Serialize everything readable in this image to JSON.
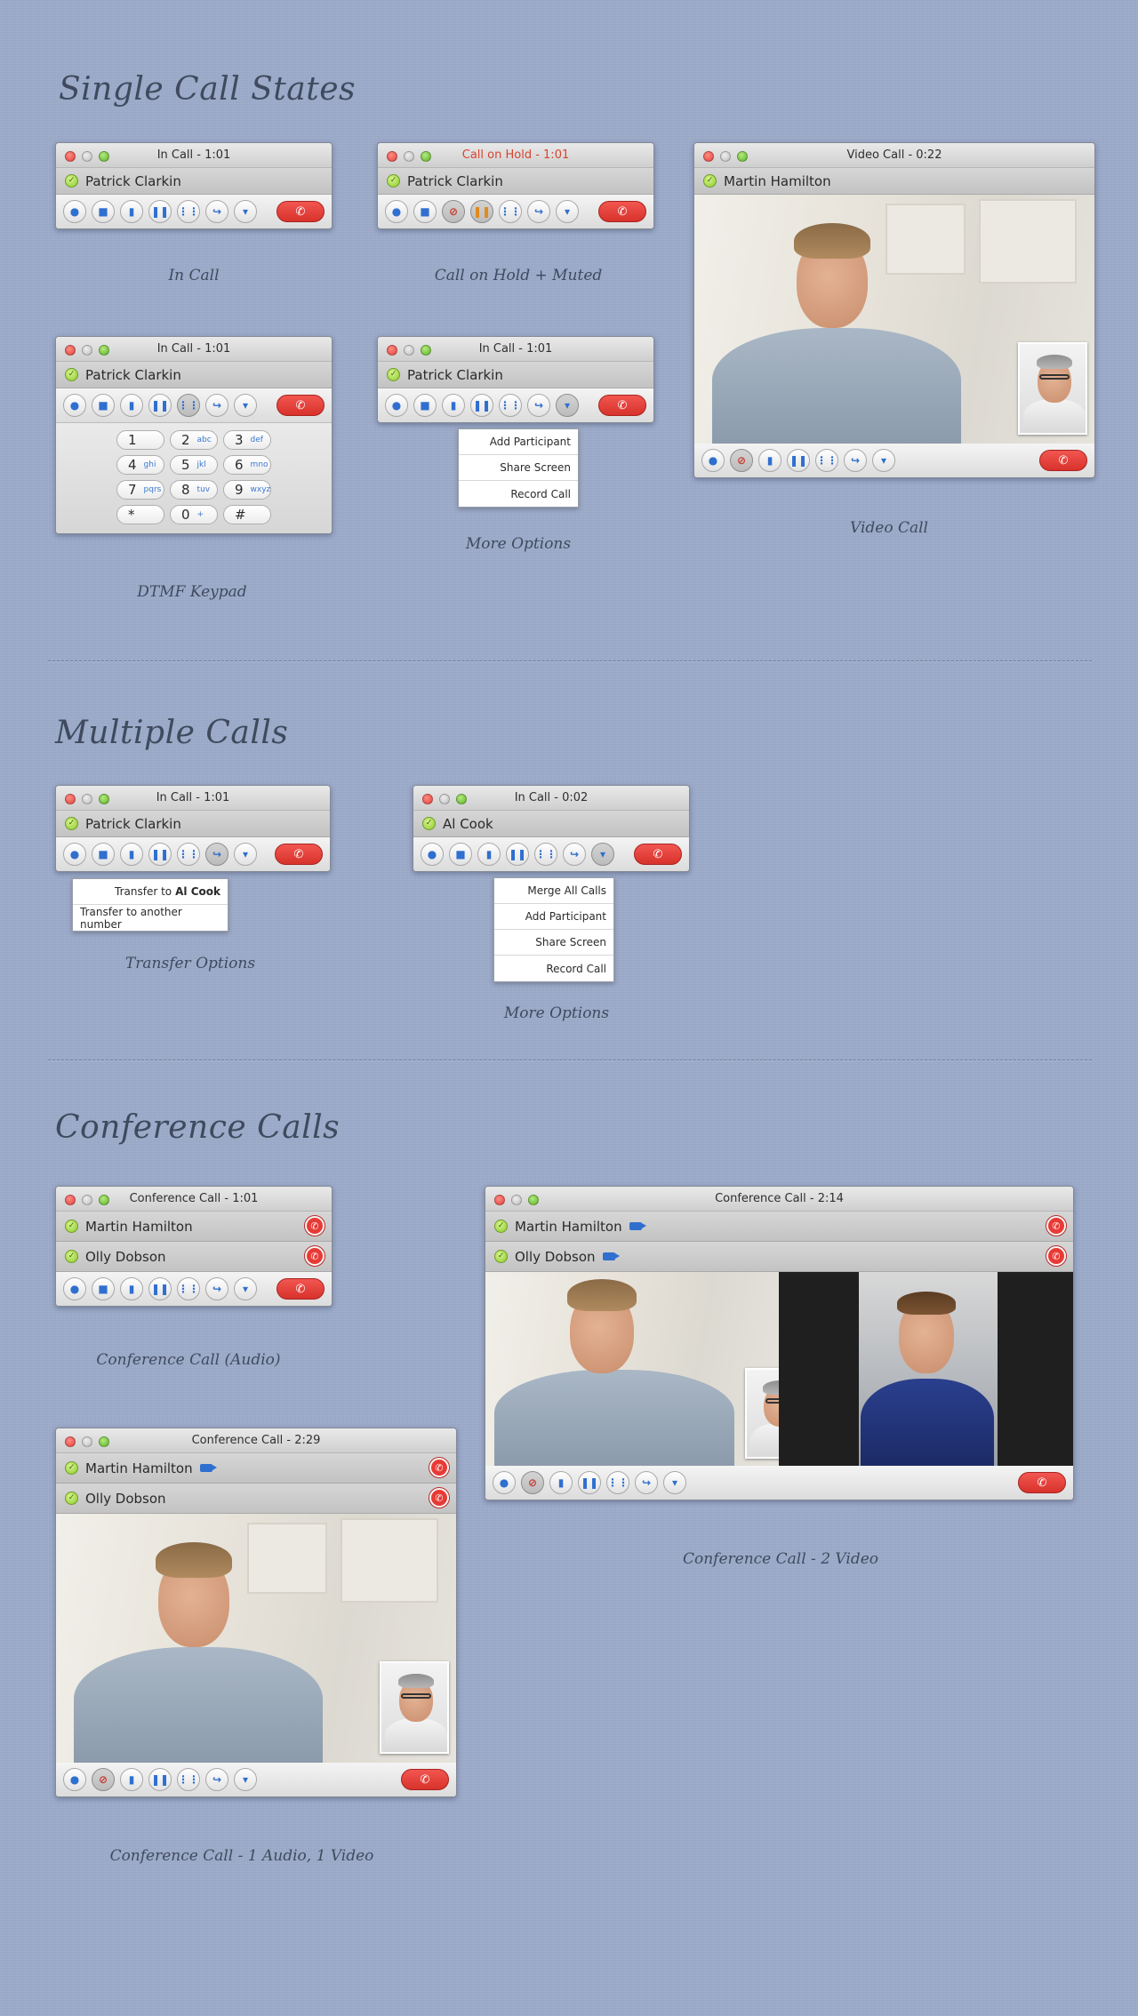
{
  "sections": {
    "single": "Single Call States",
    "multiple": "Multiple Calls",
    "conference": "Conference Calls"
  },
  "captions": {
    "in_call": "In Call",
    "hold_muted": "Call on Hold + Muted",
    "video_call": "Video Call",
    "dtmf": "DTMF Keypad",
    "more_options_1": "More Options",
    "transfer": "Transfer Options",
    "more_options_2": "More Options",
    "conf_audio": "Conference Call (Audio)",
    "conf_2video": "Conference Call - 2 Video",
    "conf_1a1v": "Conference Call - 1 Audio, 1 Video"
  },
  "windows": {
    "w1": {
      "title": "In Call - 1:01",
      "callee": "Patrick Clarkin"
    },
    "w2": {
      "title": "Call on Hold - 1:01",
      "callee": "Patrick Clarkin"
    },
    "w3": {
      "title": "Video Call - 0:22",
      "callee": "Martin Hamilton"
    },
    "w4": {
      "title": "In Call - 1:01",
      "callee": "Patrick Clarkin"
    },
    "w5": {
      "title": "In Call - 1:01",
      "callee": "Patrick Clarkin"
    },
    "w6": {
      "title": "In Call - 1:01",
      "callee": "Patrick Clarkin"
    },
    "w7": {
      "title": "In Call - 0:02",
      "callee": "Al Cook"
    },
    "w8": {
      "title": "Conference Call - 1:01",
      "p1": "Martin Hamilton",
      "p2": "Olly Dobson"
    },
    "w9": {
      "title": "Conference Call - 2:14",
      "p1": "Martin Hamilton",
      "p2": "Olly Dobson"
    },
    "w10": {
      "title": "Conference Call - 2:29",
      "p1": "Martin Hamilton",
      "p2": "Olly Dobson"
    }
  },
  "keypad": [
    [
      {
        "d": "1",
        "s": ""
      },
      {
        "d": "2",
        "s": "abc"
      },
      {
        "d": "3",
        "s": "def"
      }
    ],
    [
      {
        "d": "4",
        "s": "ghi"
      },
      {
        "d": "5",
        "s": "jkl"
      },
      {
        "d": "6",
        "s": "mno"
      }
    ],
    [
      {
        "d": "7",
        "s": "pqrs"
      },
      {
        "d": "8",
        "s": "tuv"
      },
      {
        "d": "9",
        "s": "wxyz"
      }
    ],
    [
      {
        "d": "*",
        "s": ""
      },
      {
        "d": "0",
        "s": "+"
      },
      {
        "d": "#",
        "s": ""
      }
    ]
  ],
  "menus": {
    "more1": [
      "Add Participant",
      "Share Screen",
      "Record Call"
    ],
    "transfer": {
      "to_prefix": "Transfer to",
      "to_name": "Al Cook",
      "other": "Transfer to another number"
    },
    "more2": [
      "Merge All Calls",
      "Add Participant",
      "Share Screen",
      "Record Call"
    ]
  },
  "icons": {
    "chat": "chat-icon",
    "video": "video-camera-icon",
    "mic": "microphone-icon",
    "pause": "pause-icon",
    "keypad": "keypad-icon",
    "transfer": "transfer-icon",
    "more": "chevron-down-icon",
    "hangup": "hang-up-icon"
  },
  "colors": {
    "background": "#99a8c7",
    "hangup": "#e83a35",
    "accent": "#2f6fcf",
    "hold_title": "#d8432f"
  }
}
